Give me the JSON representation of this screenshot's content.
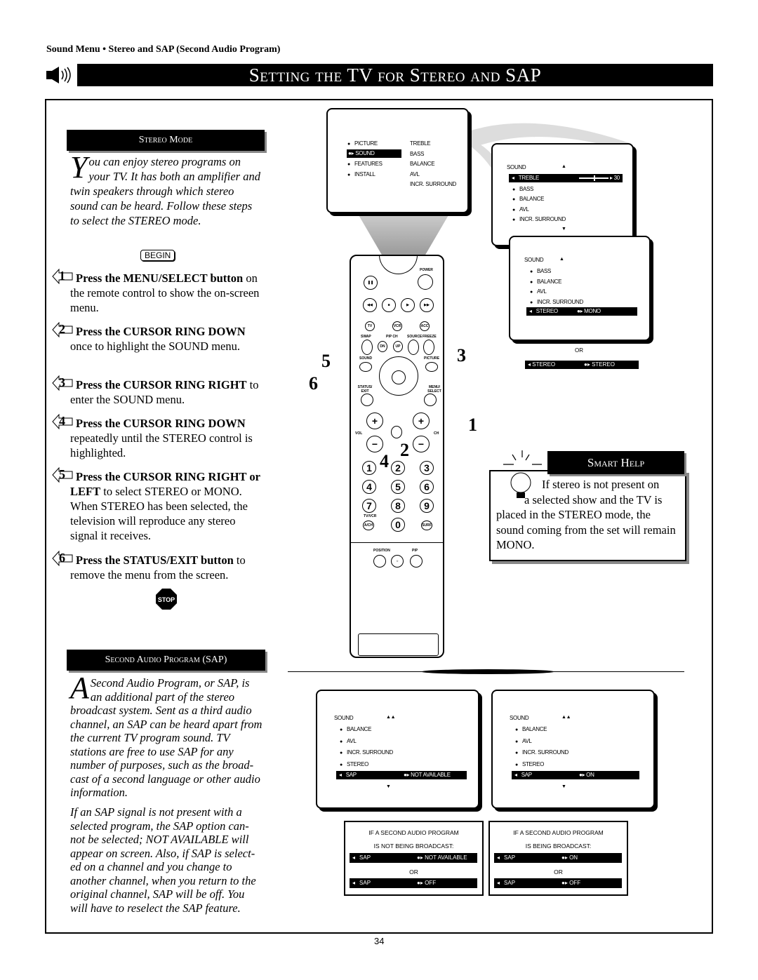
{
  "header": {
    "breadcrumb": "Sound Menu • Stereo and SAP (Second Audio Program)",
    "title": "Setting the TV for Stereo and SAP"
  },
  "stereo": {
    "heading": "Stereo Mode",
    "intro_drop": "Y",
    "intro": "ou can enjoy stereo programs on your TV. It has both an amplifier and twin speakers through which stereo sound can be heard. Follow these steps to select the STEREO mode.",
    "begin": "BEGIN",
    "steps": [
      {
        "n": "1",
        "bold": "Press the MENU/SELECT button",
        "text": " on the remote control to show the on-screen menu."
      },
      {
        "n": "2",
        "bold": "Press the CURSOR RING DOWN",
        "text": " once to highlight the SOUND menu."
      },
      {
        "n": "3",
        "bold": "Press the CURSOR RING RIGHT",
        "text": " to enter the SOUND menu."
      },
      {
        "n": "4",
        "bold": "Press the CURSOR RING DOWN",
        "text": " repeatedly until the STEREO control is highlighted."
      },
      {
        "n": "5",
        "bold": "Press the CURSOR RING RIGHT or LEFT",
        "text": " to select STEREO or MONO. When STEREO has been selected, the television will reproduce any stereo signal it receives."
      },
      {
        "n": "6",
        "bold": "Press the STATUS/EXIT button",
        "text": " to remove the menu from the screen."
      }
    ],
    "stop": "STOP"
  },
  "sap": {
    "heading": "Second Audio Program (SAP)",
    "intro_drop": "A",
    "intro": "Second Audio Program, or SAP, is an additional part of the stereo broadcast system. Sent as a third audio channel, an SAP can be heard apart from the current TV program sound. TV stations are free to use SAP for any number of purposes, such as the broad-cast of a second language or other audio information.",
    "note": "If an SAP signal is not present with a selected program, the SAP option can-not be selected; NOT AVAILABLE will appear on screen. Also, if SAP is select-ed on a channel and you change to another channel, when you return to the original channel, SAP will be off. You will have to reselect the SAP feature."
  },
  "main_menu": {
    "left": [
      "PICTURE",
      "SOUND",
      "FEATURES",
      "INSTALL"
    ],
    "right": [
      "TREBLE",
      "BASS",
      "BALANCE",
      "AVL",
      "INCR. SURROUND"
    ],
    "selected": "SOUND"
  },
  "sound_menu_1": {
    "title": "SOUND",
    "items": [
      "TREBLE",
      "BASS",
      "BALANCE",
      "AVL",
      "INCR. SURROUND"
    ],
    "selected": "TREBLE",
    "value": "30",
    "level": 30
  },
  "sound_menu_2": {
    "title": "SOUND",
    "items": [
      "BASS",
      "BALANCE",
      "AVL",
      "INCR. SURROUND",
      "STEREO"
    ],
    "selected": "STEREO",
    "value": "MONO"
  },
  "or": "OR",
  "stereo_alt": {
    "label": "STEREO",
    "value": "STEREO"
  },
  "sap_menu_1": {
    "title": "SOUND",
    "items": [
      "BALANCE",
      "AVL",
      "INCR. SURROUND",
      "STEREO",
      "SAP"
    ],
    "selected": "SAP",
    "value": "NOT AVAILABLE"
  },
  "sap_menu_2": {
    "title": "SOUND",
    "items": [
      "BALANCE",
      "AVL",
      "INCR. SURROUND",
      "STEREO",
      "SAP"
    ],
    "selected": "SAP",
    "value": "ON"
  },
  "sap_box_1": {
    "line1": "IF A SECOND AUDIO PROGRAM",
    "line2": "IS NOT BEING BROADCAST:",
    "a_label": "SAP",
    "a_value": "NOT AVAILABLE",
    "b_label": "SAP",
    "b_value": "OFF"
  },
  "sap_box_2": {
    "line1": "IF A SECOND AUDIO PROGRAM",
    "line2": "IS BEING BROADCAST:",
    "a_label": "SAP",
    "a_value": "ON",
    "b_label": "SAP",
    "b_value": "OFF"
  },
  "smart_help": {
    "title": "Smart Help",
    "text1": "If stereo is not present on",
    "text2": "a selected show and the TV is placed in the STEREO mode, the sound coming from the set will remain MONO."
  },
  "remote": {
    "power": "POWER",
    "tv": "TV",
    "vcr": "VCR",
    "acc": "ACC",
    "swap": "SWAP",
    "pipch": "PIP CH",
    "dn": "DN",
    "up": "UP",
    "source": "SOURCE",
    "freeze": "FREEZE",
    "sound": "SOUND",
    "picture": "PICTURE",
    "status": "STATUS/ EXIT",
    "menu": "MENU/ SELECT",
    "vol": "VOL",
    "ch": "CH",
    "tvvcr": "TV/VCR",
    "ach": "A/CH",
    "surf": "SURF",
    "position": "POSITION",
    "pip": "PIP",
    "digits": [
      "1",
      "2",
      "3",
      "4",
      "5",
      "6",
      "7",
      "8",
      "9",
      "0"
    ]
  },
  "callouts": [
    "5",
    "6",
    "3",
    "1",
    "4",
    "2"
  ],
  "page_number": "34"
}
